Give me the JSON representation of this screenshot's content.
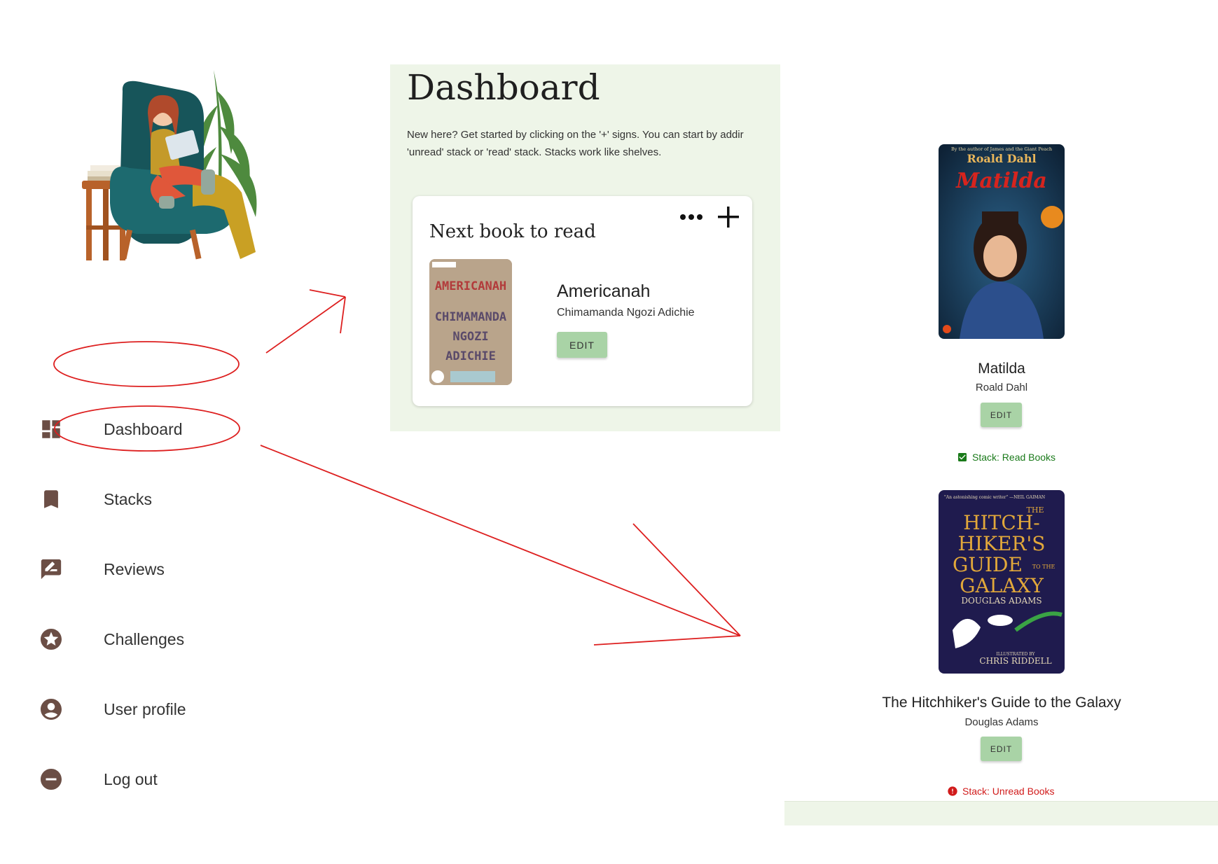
{
  "colors": {
    "accent_green": "#a9d3a6",
    "panel_bg": "#eef5e8",
    "icon_brown": "#6b4e45",
    "annotation_red": "#dd1f1f",
    "read_green": "#1a7a1a",
    "unread_red": "#d11b1b"
  },
  "sidebar": {
    "items": [
      {
        "label": "Dashboard",
        "icon": "dashboard-icon"
      },
      {
        "label": "Stacks",
        "icon": "bookmark-icon"
      },
      {
        "label": "Reviews",
        "icon": "rate-review-icon"
      },
      {
        "label": "Challenges",
        "icon": "star-circle-icon"
      },
      {
        "label": "User profile",
        "icon": "account-circle-icon"
      },
      {
        "label": "Log out",
        "icon": "minus-circle-icon"
      }
    ]
  },
  "dashboard": {
    "title": "Dashboard",
    "intro_line1": "New here? Get started by clicking on the '+' signs. You can start by addir",
    "intro_line2": "'unread' stack or 'read' stack. Stacks work like shelves.",
    "card": {
      "title": "Next book to read",
      "book": {
        "title": "Americanah",
        "author": "Chimamanda Ngozi Adichie",
        "edit_label": "EDIT",
        "cover_text": [
          "AMERICANAH",
          "CHIMAMANDA",
          "NGOZI",
          "ADICHIE"
        ]
      }
    }
  },
  "stack_books": [
    {
      "title": "Matilda",
      "author": "Roald Dahl",
      "edit_label": "EDIT",
      "stack_label": "Stack: Read Books",
      "stack_icon": "checkbox-checked-icon",
      "cover_text": {
        "top": "By the author of James and the Giant Peach",
        "author": "Roald Dahl",
        "title": "Matilda"
      }
    },
    {
      "title": "The Hitchhiker's Guide to the Galaxy",
      "author": "Douglas Adams",
      "edit_label": "EDIT",
      "stack_label": "Stack: Unread Books",
      "stack_icon": "error-circle-icon",
      "cover_text": {
        "quote": "\"An astonishing comic writer\" —NEIL GAIMAN",
        "the": "THE",
        "l1": "HITCH-",
        "l2": "HIKER'S",
        "l3": "GUIDE",
        "tothe": "TO THE",
        "l4": "GALAXY",
        "author": "DOUGLAS ADAMS",
        "illus": "ILLUSTRATED BY",
        "illustrator": "CHRIS RIDDELL"
      }
    }
  ]
}
